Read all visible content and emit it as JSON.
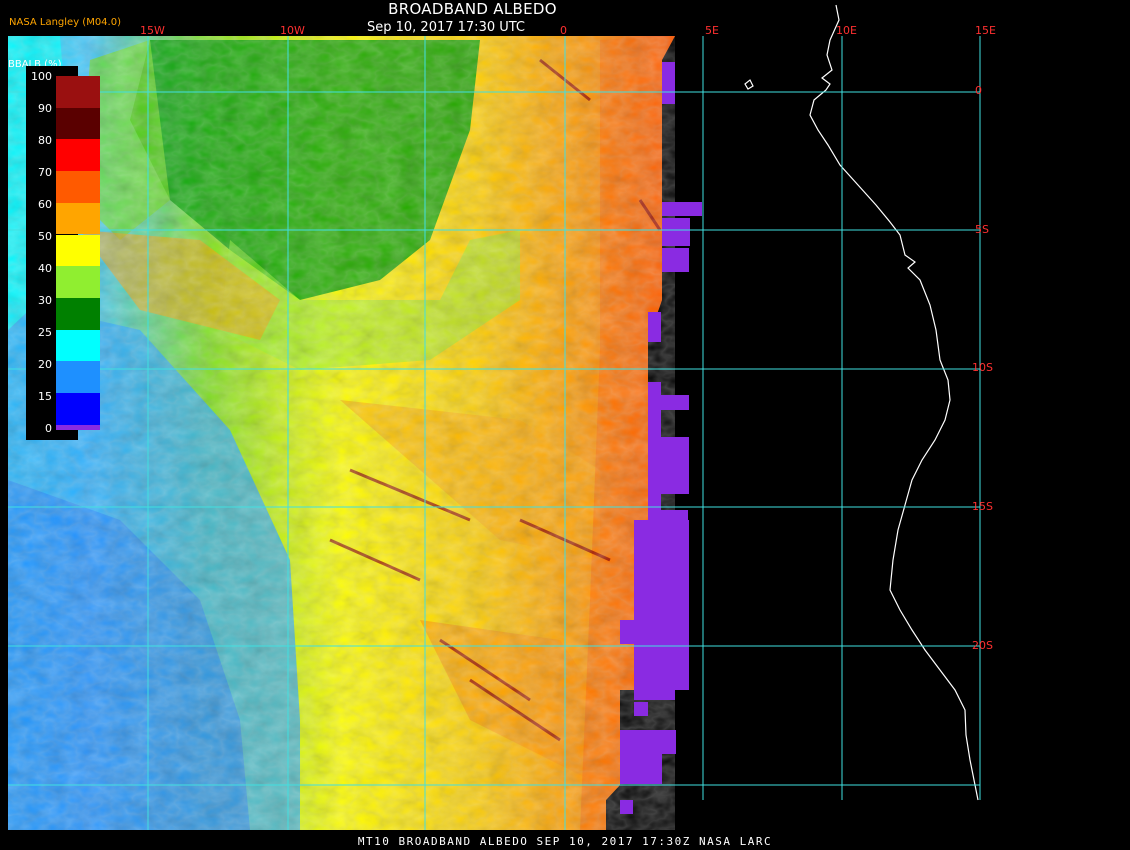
{
  "header": {
    "title": "BROADBAND ALBEDO",
    "subtitle": "Sep 10, 2017 17:30 UTC",
    "credit": "NASA Langley (M04.0)"
  },
  "footer": {
    "text": "MT10  BROADBAND ALBEDO   SEP 10, 2017 17:30Z   NASA LARC"
  },
  "legend": {
    "title": "BBALB (%)",
    "labels": [
      "100",
      "90",
      "80",
      "70",
      "60",
      "50",
      "40",
      "30",
      "25",
      "20",
      "15",
      "10",
      "0"
    ],
    "colors": [
      "#9a1010",
      "#5a0000",
      "#ff0000",
      "#ff5a00",
      "#ffa500",
      "#ffff00",
      "#90ee30",
      "#008000",
      "#00ffff",
      "#1e90ff",
      "#0000ff",
      "#8a2be2"
    ]
  },
  "map": {
    "grid_color": "#40e0e0",
    "longitude_labels": [
      "15W",
      "10W",
      "0",
      "5E",
      "10E",
      "15E"
    ],
    "latitude_labels": [
      "0",
      "5S",
      "10S",
      "15S",
      "20S"
    ]
  }
}
